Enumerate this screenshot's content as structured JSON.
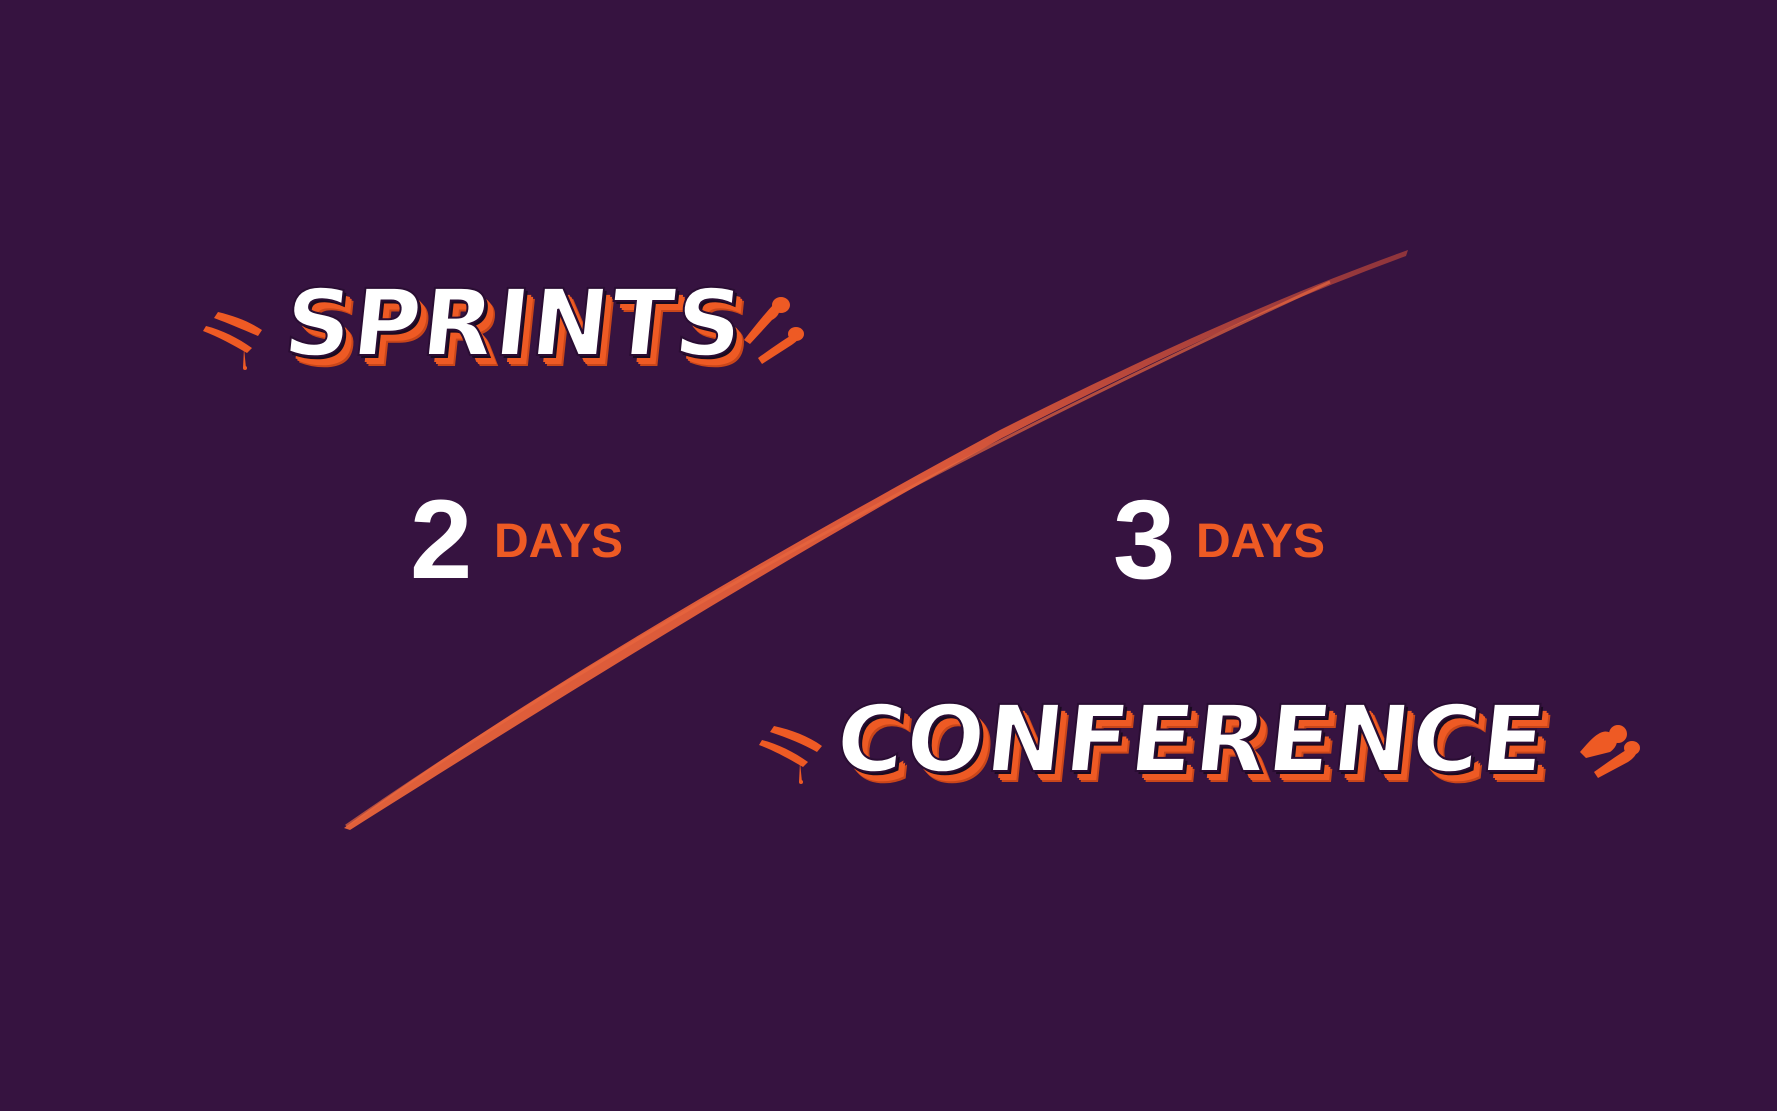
{
  "sprints": {
    "title": "SPRINTS",
    "days_value": "2",
    "days_unit": "DAYS"
  },
  "conference": {
    "title": "CONFERENCE",
    "days_value": "3",
    "days_unit": "DAYS"
  },
  "colors": {
    "background": "#361340",
    "accent": "#ee5a24",
    "slash": "#d9573a",
    "text": "#ffffff"
  },
  "icons": [
    "left-splash-icon",
    "right-splash-icon",
    "diagonal-brush-stroke-icon"
  ]
}
